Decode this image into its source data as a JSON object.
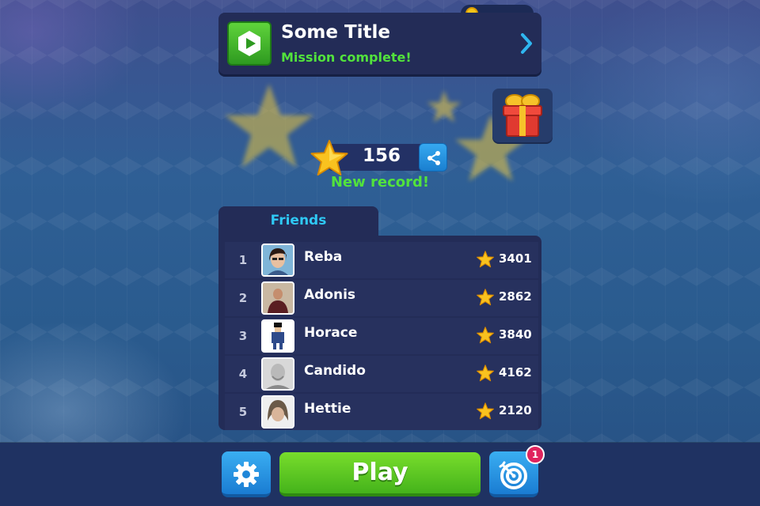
{
  "currency": {
    "icon": "coin-icon",
    "amount": ""
  },
  "mission": {
    "icon": "play-icon",
    "title": "Some Title",
    "status": "Mission complete!",
    "chevron": "chevron-right-icon"
  },
  "gift": {
    "icon": "gift-icon"
  },
  "score": {
    "icon": "star-icon",
    "value": "156",
    "share_icon": "share-icon",
    "record_label": "New record!"
  },
  "leaderboard": {
    "tab_label": "Friends",
    "rows": [
      {
        "rank": "1",
        "name": "Reba",
        "score": "3401"
      },
      {
        "rank": "2",
        "name": "Adonis",
        "score": "2862"
      },
      {
        "rank": "3",
        "name": "Horace",
        "score": "3840"
      },
      {
        "rank": "4",
        "name": "Candido",
        "score": "4162"
      },
      {
        "rank": "5",
        "name": "Hettie",
        "score": "2120"
      }
    ]
  },
  "bottom": {
    "settings_icon": "gear-icon",
    "play_label": "Play",
    "target_icon": "target-icon",
    "notification_count": "1"
  },
  "colors": {
    "accent_green": "#52e23c",
    "accent_cyan": "#2fc9f5",
    "button_blue": "#1a7cd2",
    "play_green": "#45b31b",
    "panel": "#232c57",
    "badge_red": "#e0245e"
  }
}
